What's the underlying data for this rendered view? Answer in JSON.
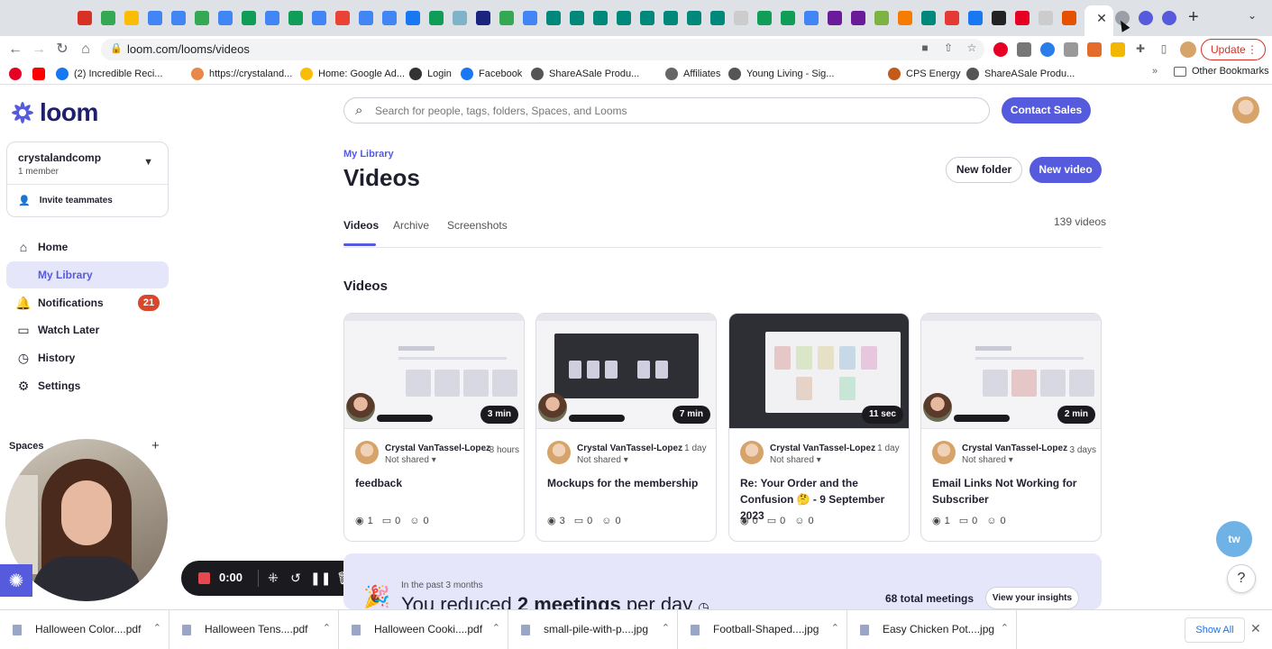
{
  "browser": {
    "url": "loom.com/looms/videos",
    "update_label": "Update",
    "bookmarks": [
      {
        "label": "(2) Incredible Reci...",
        "color": "#1877f2"
      },
      {
        "label": "https://crystaland...",
        "color": "#e8894a"
      },
      {
        "label": "Home: Google Ad...",
        "color": "#fbbc04"
      },
      {
        "label": "Login",
        "color": "#333333"
      },
      {
        "label": "Facebook",
        "color": "#1877f2"
      },
      {
        "label": "ShareASale Produ...",
        "color": "#555555"
      },
      {
        "label": "Affiliates",
        "color": "#666666"
      },
      {
        "label": "Young Living - Sig...",
        "color": "#555555"
      },
      {
        "label": "CPS Energy",
        "color": "#c15a1a"
      },
      {
        "label": "ShareASale Produ...",
        "color": "#555555"
      }
    ],
    "bookmarks_more": "»",
    "other_bookmarks": "Other Bookmarks"
  },
  "sidebar": {
    "logo_text": "loom",
    "workspace": {
      "name": "crystalandcomp",
      "members": "1 member",
      "invite_label": "Invite teammates"
    },
    "nav": [
      {
        "label": "Home",
        "icon": "home-icon"
      },
      {
        "label": "My Library",
        "icon": "library-icon"
      },
      {
        "label": "Notifications",
        "icon": "bell-icon",
        "badge": "21"
      },
      {
        "label": "Watch Later",
        "icon": "bookmark-icon"
      },
      {
        "label": "History",
        "icon": "clock-icon"
      },
      {
        "label": "Settings",
        "icon": "gear-icon"
      }
    ],
    "spaces_label": "Spaces"
  },
  "recorder": {
    "time": "0:00"
  },
  "header": {
    "search_placeholder": "Search for people, tags, folders, Spaces, and Looms",
    "contact_sales": "Contact Sales"
  },
  "main": {
    "breadcrumb": "My Library",
    "title": "Videos",
    "new_folder": "New folder",
    "new_video": "New video",
    "tabs": [
      "Videos",
      "Archive",
      "Screenshots"
    ],
    "video_count": "139 videos",
    "section_title": "Videos",
    "videos": [
      {
        "duration": "3 min",
        "author": "Crystal VanTassel-Lopez",
        "time": "8 hours",
        "share": "Not shared",
        "title": "feedback",
        "views": "1",
        "comments": "0",
        "reactions": "0"
      },
      {
        "duration": "7 min",
        "author": "Crystal VanTassel-Lopez",
        "time": "1 day",
        "share": "Not shared",
        "title": "Mockups for the membership",
        "views": "3",
        "comments": "0",
        "reactions": "0"
      },
      {
        "duration": "11 sec",
        "author": "Crystal VanTassel-Lopez",
        "time": "1 day",
        "share": "Not shared",
        "title": "Re: Your Order and the Confusion 🤔 - 9 September 2023",
        "views": "0",
        "comments": "0",
        "reactions": "0"
      },
      {
        "duration": "2 min",
        "author": "Crystal VanTassel-Lopez",
        "time": "3 days",
        "share": "Not shared",
        "title": "Email Links Not Working for Subscriber",
        "views": "1",
        "comments": "0",
        "reactions": "0"
      }
    ],
    "insights": {
      "subtitle": "In the past 3 months",
      "headline_start": "You reduced ",
      "headline_bold": "2 meetings",
      "headline_end": " per day",
      "total_meetings": "68 total meetings",
      "cta": "View your insights"
    }
  },
  "downloads": {
    "files": [
      "Halloween Color....pdf",
      "Halloween Tens....pdf",
      "Halloween Cooki....pdf",
      "small-pile-with-p....jpg",
      "Football-Shaped....jpg",
      "Easy Chicken Pot....jpg"
    ],
    "show_all": "Show All"
  },
  "colors": {
    "accent": "#565add",
    "badge": "#d9472b"
  }
}
